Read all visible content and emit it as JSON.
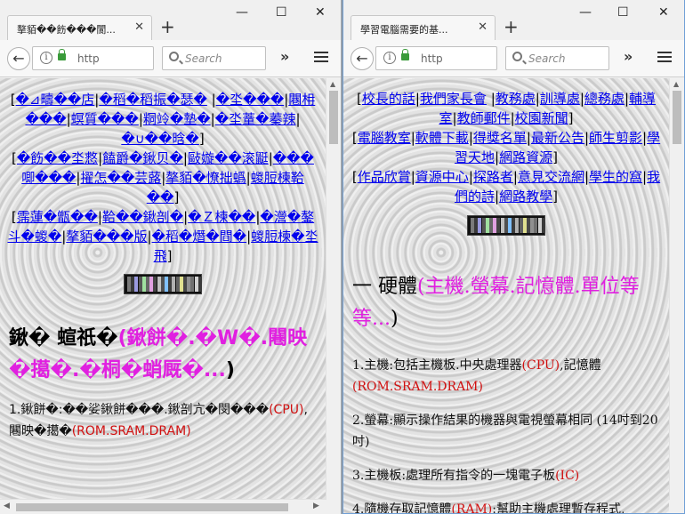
{
  "common": {
    "new_tab": "+",
    "url_placeholder": "http",
    "search_placeholder": "Search",
    "window_controls": {
      "minimize": "—",
      "maximize": "☐",
      "close": "✕"
    }
  },
  "left": {
    "tab_title": "摮貊��飭���閬...",
    "links_lines": [
      [
        "[",
        "�⊿疇��店",
        "|",
        "�稻�稻振�瑟�",
        " |",
        "�坔���",
        "|",
        "闀枏���",
        "|",
        "螟質���",
        "|",
        "粡竛�墊�",
        "|",
        "�坔蕫�蓁辣",
        "|",
        "�∪��晗�",
        "]"
      ],
      [
        "[",
        "�飭��坔慦",
        "|",
        "饁爵�鍬贝�",
        "|",
        "敺嫙��滚鼮",
        "|",
        "���唧���",
        "|",
        "擢怎��芸蕗",
        "|",
        "摮貊�憭拙蟡",
        "|",
        "蝬脰楝鞈��",
        "]"
      ],
      [
        "[",
        "霈蓮�甑��",
        "|",
        "鞈��鍬剖�",
        "|",
        "�Ｚ楝��",
        "|",
        "�瀯�鏊斗�蝬�",
        "|",
        "摮貊���版",
        "|",
        "�稻�熸�閰�",
        "|",
        "蝬脰楝�坔飛",
        "]"
      ]
    ],
    "heading_part1": "鍬�  蝖祇�",
    "heading_part2": "(鍬餅�.�W�.闀映�擖�.�桐�蛸厩�...",
    "heading_close": ")",
    "p1_text1": "1.鍬餅�:��娑鍬餅���.鍬剖亢�閔���",
    "p1_red1": "(CPU)",
    "p1_text2": ",闀映�擖�",
    "p1_red2": "(ROM.SRAM.DRAM)"
  },
  "right": {
    "tab_title": "學習電腦需要的基...",
    "links_lines": [
      [
        "[",
        "校長的話",
        "|",
        "我們家長會",
        " |",
        "教務處",
        "|",
        "訓導處",
        "|",
        "總務處",
        "|",
        "輔導室",
        "|",
        "教師郵件",
        "|",
        "校園新聞",
        "]"
      ],
      [
        "[",
        "電腦教室",
        "|",
        "軟體下載",
        "|",
        "得獎名單",
        "|",
        "最新公告",
        "|",
        "師生剪影",
        "|",
        "學習天地",
        "|",
        "網路資源",
        "]"
      ],
      [
        "[",
        "作品欣賞",
        "|",
        "資源中心",
        "|",
        "探路者",
        "|",
        "意見交流網",
        "|",
        "學生的窩",
        "|",
        "我們的詩",
        "|",
        "網路教學",
        "]"
      ]
    ],
    "heading_part1": "一 硬體",
    "heading_part2": "(主機.螢幕.記憶體.單位等等...",
    "heading_close": ")",
    "paras": [
      {
        "t1": "1.主機:包括主機板.中央處理器",
        "r1": "(CPU)",
        "t2": ",記憶體",
        "r2": "(ROM.SRAM.DRAM)",
        "t3": ""
      },
      {
        "t1": "2.螢幕:顯示操作結果的機器與電視螢幕相同 (14吋到20吋)",
        "r1": "",
        "t2": "",
        "r2": "",
        "t3": ""
      },
      {
        "t1": "3.主機板:處理所有指令的一塊電子板",
        "r1": "(IC)",
        "t2": "",
        "r2": "",
        "t3": ""
      },
      {
        "t1": "4.隨機存取記憶體",
        "r1": "(RAM)",
        "t2": ":幫助主機處理暫存程式,",
        "r2": "",
        "t3": ""
      }
    ]
  },
  "colors": {
    "link": "#0000ee",
    "heading_accent": "#e020e0",
    "red_text": "#d01010",
    "active_border": "#6f9fd6"
  }
}
